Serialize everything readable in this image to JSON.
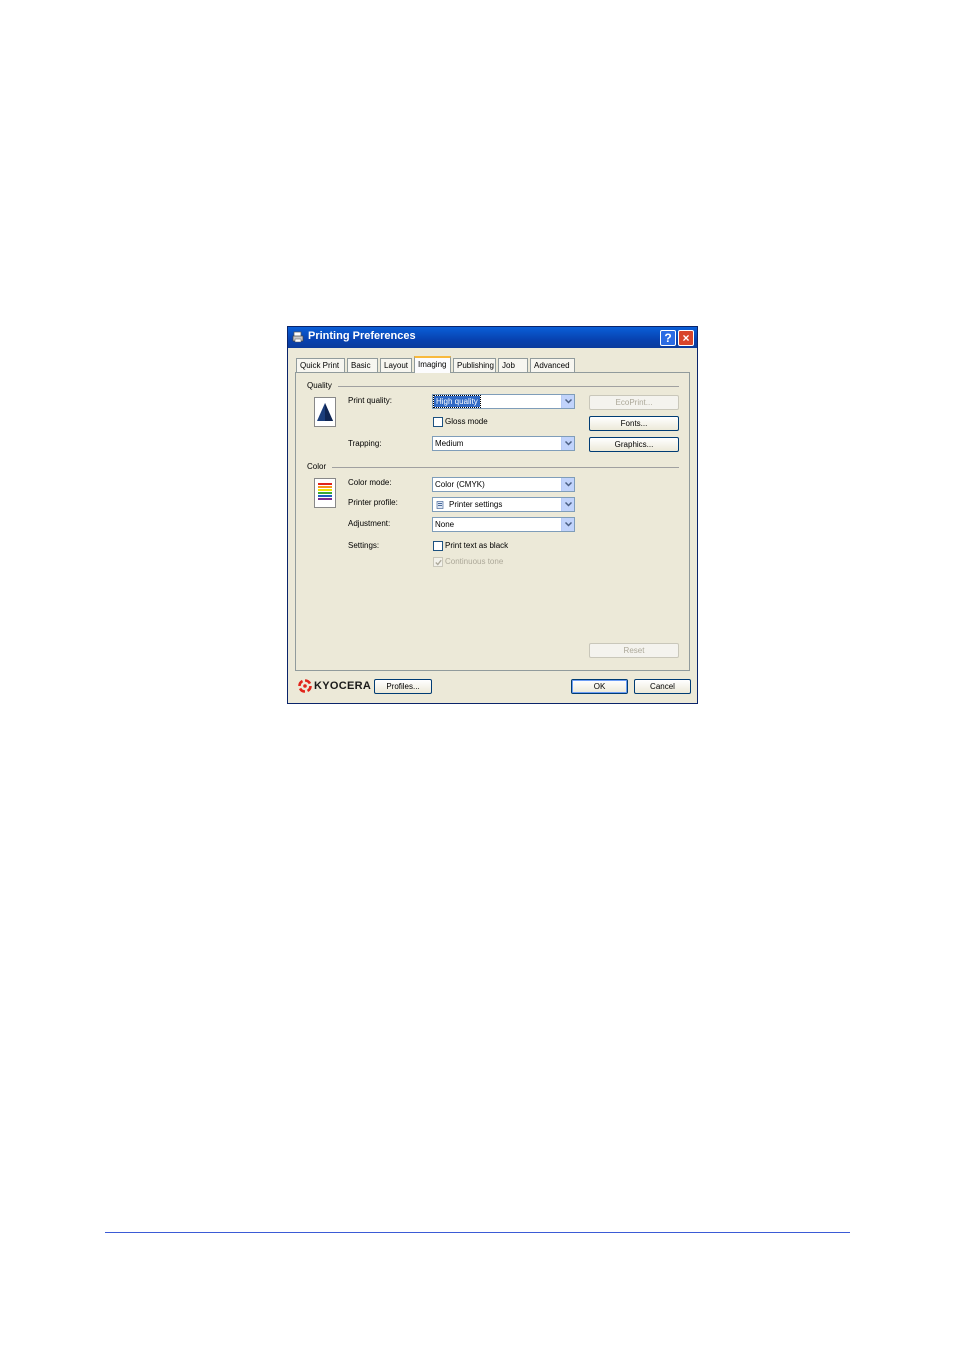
{
  "window": {
    "title": "Printing Preferences",
    "title_buttons": {
      "help": "?",
      "close": "×"
    }
  },
  "tabs": [
    {
      "label": "Quick Print",
      "active": false
    },
    {
      "label": "Basic",
      "active": false
    },
    {
      "label": "Layout",
      "active": false
    },
    {
      "label": "Imaging",
      "active": true
    },
    {
      "label": "Publishing",
      "active": false
    },
    {
      "label": "Job",
      "active": false
    },
    {
      "label": "Advanced",
      "active": false
    }
  ],
  "quality": {
    "group_label": "Quality",
    "print_quality_label": "Print quality:",
    "print_quality_value": "High quality",
    "gloss_mode_label": "Gloss mode",
    "gloss_mode_checked": false,
    "trapping_label": "Trapping:",
    "trapping_value": "Medium",
    "ecoprint_button": "EcoPrint...",
    "fonts_button": "Fonts...",
    "graphics_button": "Graphics..."
  },
  "color": {
    "group_label": "Color",
    "color_mode_label": "Color mode:",
    "color_mode_value": "Color (CMYK)",
    "printer_profile_label": "Printer profile:",
    "printer_profile_value": "Printer settings",
    "adjustment_label": "Adjustment:",
    "adjustment_value": "None",
    "settings_label": "Settings:",
    "print_text_black_label": "Print text as black",
    "print_text_black_checked": false,
    "continuous_tone_label": "Continuous tone",
    "continuous_tone_checked": true
  },
  "reset_button": "Reset",
  "footer": {
    "brand": "KYOCERA",
    "profiles_button": "Profiles...",
    "ok_button": "OK",
    "cancel_button": "Cancel"
  },
  "colors": {
    "title_bar": "#0842b0",
    "dialog_bg": "#ece9d8",
    "brand_red": "#e1251b",
    "page_rule": "#3b5bd6"
  }
}
